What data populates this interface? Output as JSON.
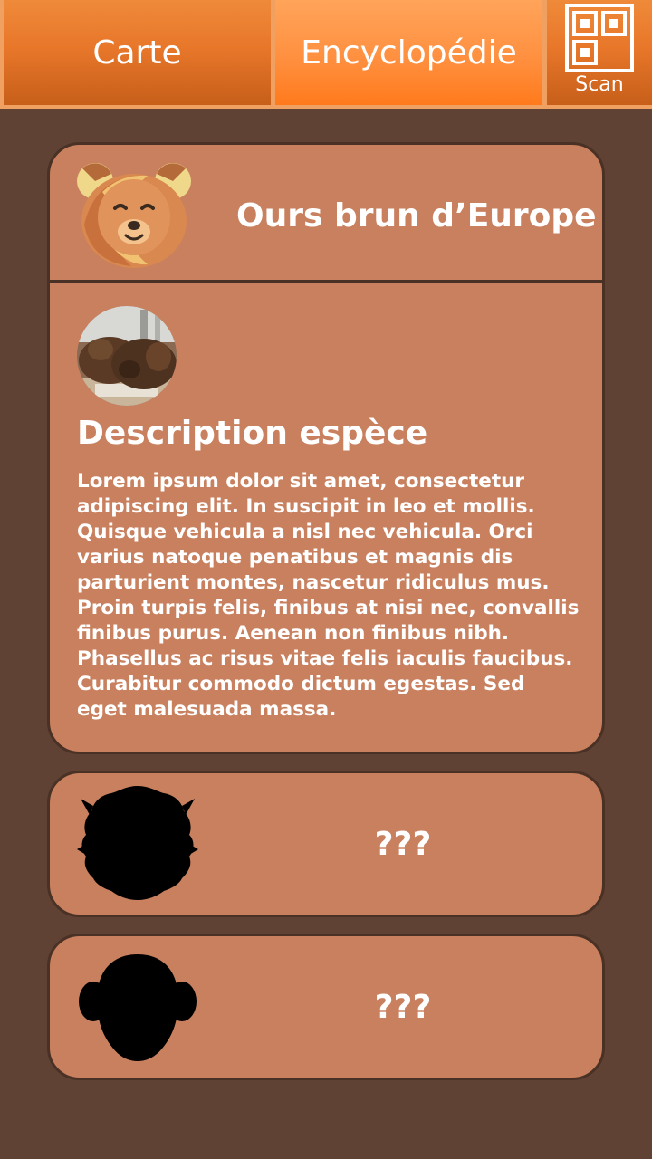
{
  "nav": {
    "tabs": [
      {
        "label": "Carte",
        "active": false
      },
      {
        "label": "Encyclopédie",
        "active": true
      }
    ],
    "scan": {
      "label": "Scan",
      "icon": "qr-code-icon"
    }
  },
  "colors": {
    "background": "#5f4233",
    "card": "#c8805f",
    "card_border": "#4a3125",
    "tab_orange": "#e8772a",
    "tab_active": "#ff9040"
  },
  "entries": [
    {
      "icon": "bear-face-icon",
      "name": "Ours brun d’Europe",
      "photo": "brown-bears-photo",
      "description_title": "Description espèce",
      "description": "Lorem ipsum dolor sit amet, consectetur adipiscing elit. In suscipit in leo et mollis. Quisque vehicula a nisl nec vehicula. Orci varius natoque penatibus et magnis dis parturient montes, nascetur ridiculus mus. Proin turpis felis, finibus at nisi nec, convallis finibus purus. Aenean non finibus nibh. Phasellus ac risus vitae felis iaculis faucibus. Curabitur commodo dictum egestas. Sed eget malesuada massa."
    },
    {
      "icon": "lion-silhouette-icon",
      "name": "???"
    },
    {
      "icon": "monkey-silhouette-icon",
      "name": "???"
    }
  ]
}
